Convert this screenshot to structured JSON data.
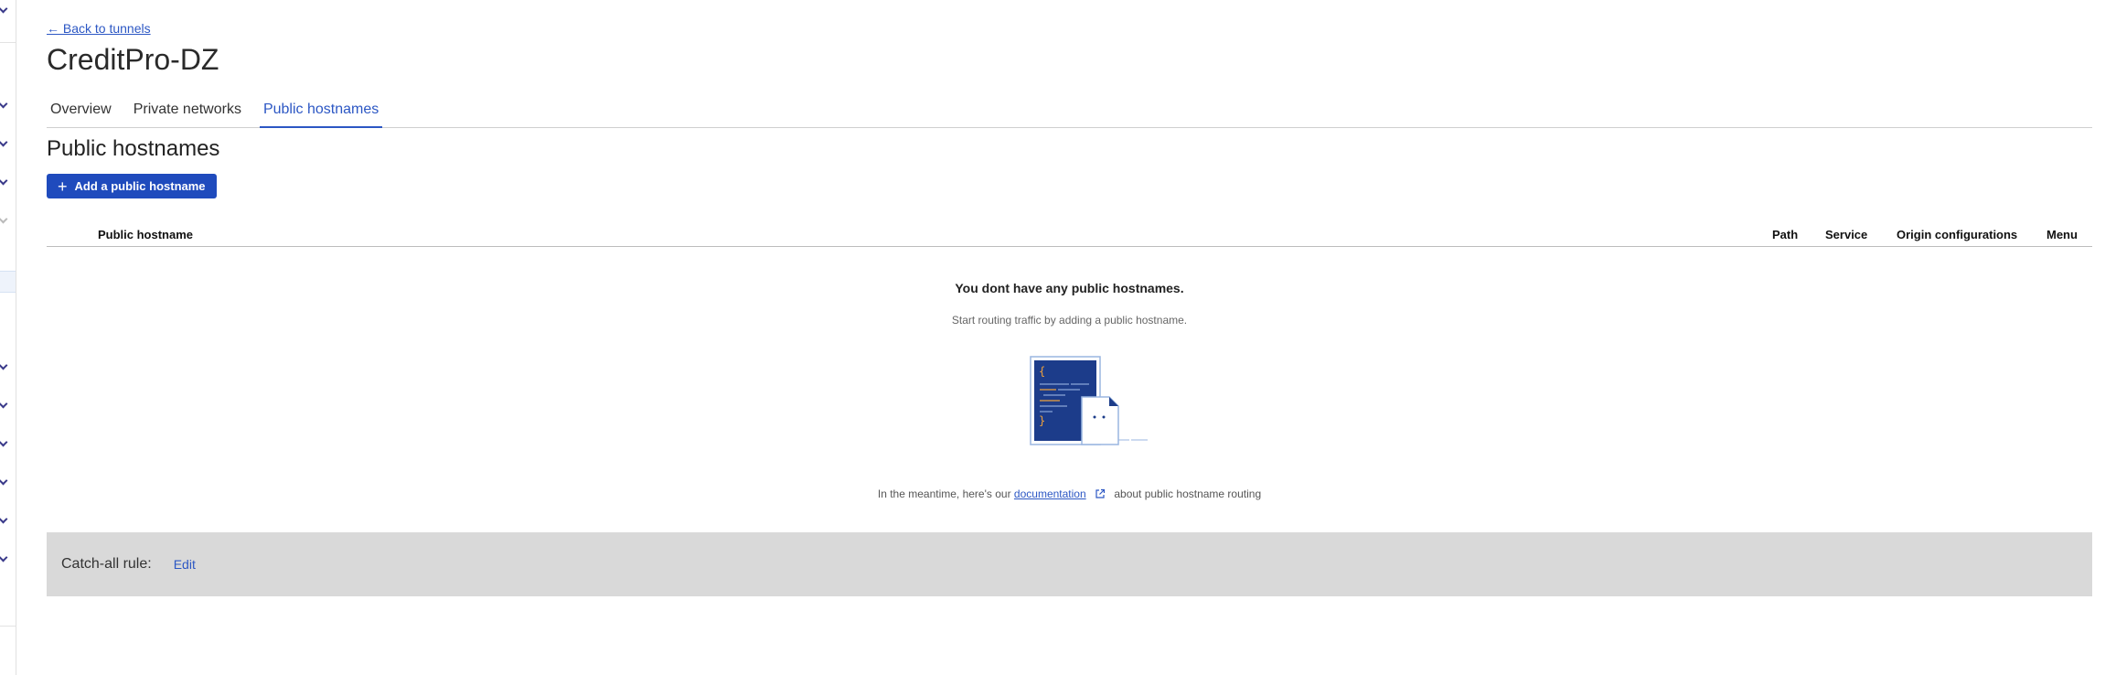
{
  "nav": {
    "back_link": "← Back to tunnels"
  },
  "page": {
    "title": "CreditPro-DZ"
  },
  "tabs": [
    {
      "label": "Overview",
      "active": false
    },
    {
      "label": "Private networks",
      "active": false
    },
    {
      "label": "Public hostnames",
      "active": true
    }
  ],
  "section": {
    "title": "Public hostnames",
    "add_button_label": "Add a public hostname"
  },
  "table": {
    "columns": [
      "Public hostname",
      "Path",
      "Service",
      "Origin configurations",
      "Menu"
    ]
  },
  "empty_state": {
    "title": "You dont have any public hostnames.",
    "subtitle": "Start routing traffic by adding a public hostname.",
    "docs_prefix": "In the meantime, here's our",
    "docs_link": "documentation",
    "docs_suffix": "about public hostname routing"
  },
  "catch_all": {
    "label": "Catch-all rule:",
    "edit_label": "Edit"
  },
  "colors": {
    "accent": "#2c57c4",
    "button_bg": "#1f4bbd",
    "catch_all_bg": "#d9d9d9",
    "illustration_dark": "#1c3c8a",
    "illustration_accent": "#f0a23c"
  }
}
